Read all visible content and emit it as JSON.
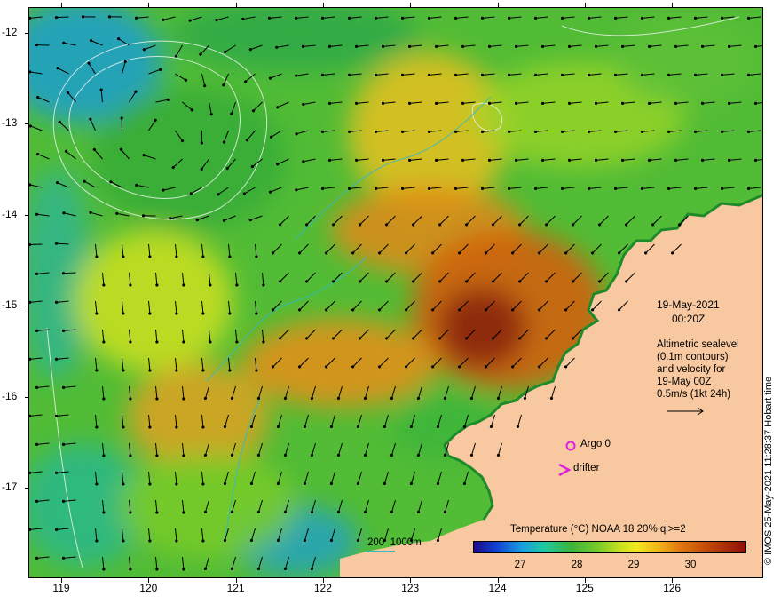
{
  "axes": {
    "y_labels": [
      "-12",
      "-13",
      "-14",
      "-15",
      "-16",
      "-17"
    ],
    "x_labels": [
      "119",
      "120",
      "121",
      "122",
      "123",
      "124",
      "125",
      "126"
    ]
  },
  "annotation": {
    "date": "19-May-2021",
    "time": "00:20Z",
    "desc_line1": "Altimetric sealevel",
    "desc_line2": "(0.1m contours)",
    "desc_line3": "and velocity for",
    "desc_line4": "19-May 00Z",
    "desc_line5": "0.5m/s (1kt 24h)"
  },
  "legend": {
    "argo_label": "Argo 0",
    "drifter_label": "drifter",
    "marker_color": "#e020e0"
  },
  "depth_scale": {
    "label": "200  1000m",
    "color": "#35b8c8"
  },
  "colorbar": {
    "title": "Temperature (°C) NOAA 18 20% ql>=2",
    "ticks": [
      "27",
      "28",
      "29",
      "30"
    ]
  },
  "credit": "© IMOS 25-May-2021 11:28:37 Hobart time",
  "colors": {
    "land": "#f8c8a0",
    "ocean_warm": "#e07810",
    "ocean_mid": "#3cb43c",
    "ocean_cool": "#1aa0e0"
  }
}
